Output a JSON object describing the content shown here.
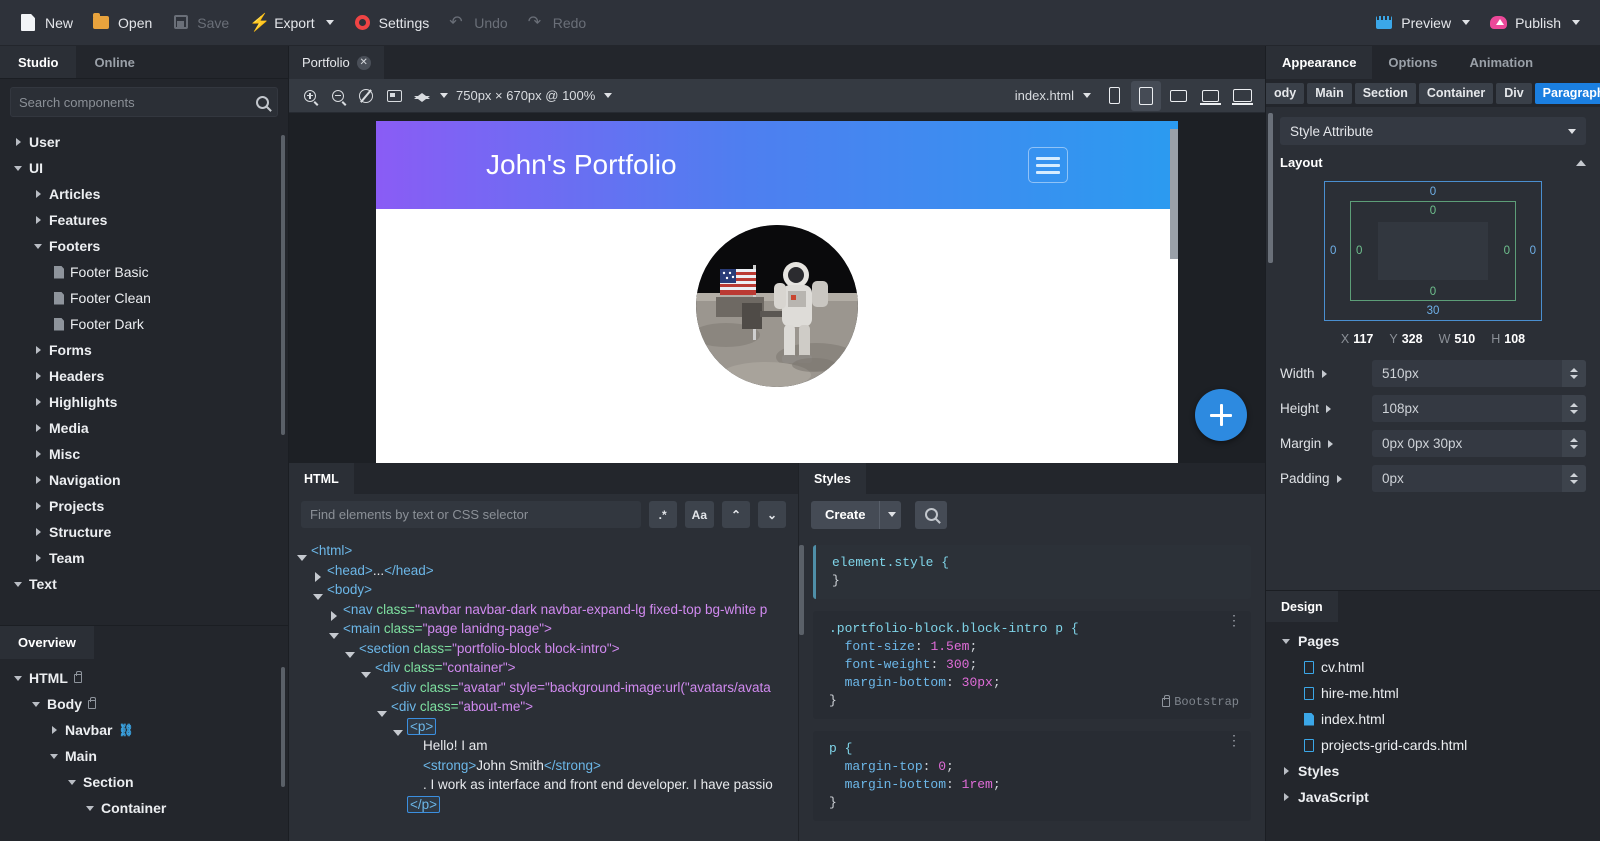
{
  "toolbar": {
    "items": [
      {
        "label": "New",
        "icon": "new-document-icon",
        "enabled": true
      },
      {
        "label": "Open",
        "icon": "open-folder-icon",
        "enabled": true
      },
      {
        "label": "Save",
        "icon": "save-disk-icon",
        "enabled": false
      },
      {
        "label": "Export",
        "icon": "export-bolt-icon",
        "enabled": true,
        "caret": true
      },
      {
        "label": "Settings",
        "icon": "settings-gear-icon",
        "enabled": true
      },
      {
        "label": "Undo",
        "icon": "undo-arrow-icon",
        "enabled": false
      },
      {
        "label": "Redo",
        "icon": "redo-arrow-icon",
        "enabled": false
      }
    ],
    "right_items": [
      {
        "label": "Preview",
        "icon": "preview-icon",
        "caret": true
      },
      {
        "label": "Publish",
        "icon": "publish-cloud-icon",
        "caret": true
      }
    ]
  },
  "left_panel": {
    "tabs": [
      {
        "label": "Studio",
        "active": true
      },
      {
        "label": "Online",
        "active": false
      }
    ],
    "search": {
      "placeholder": "Search components",
      "value": ""
    },
    "tree": [
      {
        "label": "User",
        "depth": 0,
        "state": "closed",
        "bold": true
      },
      {
        "label": "UI",
        "depth": 0,
        "state": "open",
        "bold": true
      },
      {
        "label": "Articles",
        "depth": 1,
        "state": "closed",
        "bold": true
      },
      {
        "label": "Features",
        "depth": 1,
        "state": "closed",
        "bold": true
      },
      {
        "label": "Footers",
        "depth": 1,
        "state": "open",
        "bold": true
      },
      {
        "label": "Footer Basic",
        "depth": 2,
        "state": "leaf",
        "bold": false
      },
      {
        "label": "Footer Clean",
        "depth": 2,
        "state": "leaf",
        "bold": false
      },
      {
        "label": "Footer Dark",
        "depth": 2,
        "state": "leaf",
        "bold": false
      },
      {
        "label": "Forms",
        "depth": 1,
        "state": "closed",
        "bold": true
      },
      {
        "label": "Headers",
        "depth": 1,
        "state": "closed",
        "bold": true
      },
      {
        "label": "Highlights",
        "depth": 1,
        "state": "closed",
        "bold": true
      },
      {
        "label": "Media",
        "depth": 1,
        "state": "closed",
        "bold": true
      },
      {
        "label": "Misc",
        "depth": 1,
        "state": "closed",
        "bold": true
      },
      {
        "label": "Navigation",
        "depth": 1,
        "state": "closed",
        "bold": true
      },
      {
        "label": "Projects",
        "depth": 1,
        "state": "closed",
        "bold": true
      },
      {
        "label": "Structure",
        "depth": 1,
        "state": "closed",
        "bold": true
      },
      {
        "label": "Team",
        "depth": 1,
        "state": "closed",
        "bold": true
      },
      {
        "label": "Text",
        "depth": 0,
        "state": "open",
        "bold": true
      }
    ],
    "overview": {
      "tab_label": "Overview",
      "tree": [
        {
          "label": "HTML",
          "depth": 0,
          "state": "open",
          "lock": true
        },
        {
          "label": "Body",
          "depth": 1,
          "state": "open",
          "lock": true
        },
        {
          "label": "Navbar",
          "depth": 2,
          "state": "closed",
          "link": true
        },
        {
          "label": "Main",
          "depth": 2,
          "state": "open"
        },
        {
          "label": "Section",
          "depth": 3,
          "state": "open"
        },
        {
          "label": "Container",
          "depth": 4,
          "state": "open"
        }
      ]
    }
  },
  "canvas": {
    "tab": {
      "label": "Portfolio",
      "close": "✕"
    },
    "zoom_label": "750px × 670px @ 100%",
    "file_label": "index.html",
    "tool_icons": [
      "zoom-in-icon",
      "zoom-out-icon",
      "no-style-icon",
      "fit-screen-icon",
      "layers-icon"
    ],
    "devices": [
      "phone-icon",
      "tablet-icon",
      "monitor-icon",
      "laptop-icon",
      "desktop-wide-icon"
    ],
    "active_device_index": 1,
    "preview": {
      "site_title": "John's Portfolio",
      "menu_icon": "hamburger-menu-icon",
      "avatar_alt": "astronaut-on-moon-avatar",
      "gradient_from": "#8a5cf5",
      "gradient_to": "#2b9bf0"
    },
    "fab_label": "+"
  },
  "html_panel": {
    "tab_label": "HTML",
    "find": {
      "placeholder": "Find elements by text or CSS selector",
      "value": ""
    },
    "buttons": [
      ".*",
      "Aa",
      "⌃",
      "⌄"
    ],
    "rows": [
      {
        "indent": 0,
        "tri": "o",
        "parts": [
          {
            "t": "tag",
            "v": "<html>"
          }
        ]
      },
      {
        "indent": 1,
        "tri": "c",
        "parts": [
          {
            "t": "tag",
            "v": "<head>"
          },
          {
            "t": "txt",
            "v": "..."
          },
          {
            "t": "tag",
            "v": "</head>"
          }
        ]
      },
      {
        "indent": 1,
        "tri": "o",
        "parts": [
          {
            "t": "tag",
            "v": "<body>"
          }
        ]
      },
      {
        "indent": 2,
        "tri": "c",
        "parts": [
          {
            "t": "tag",
            "v": "<nav "
          },
          {
            "t": "attr",
            "v": "class="
          },
          {
            "t": "val",
            "v": "\"navbar navbar-dark navbar-expand-lg fixed-top bg-white p"
          }
        ]
      },
      {
        "indent": 2,
        "tri": "o",
        "parts": [
          {
            "t": "tag",
            "v": "<main "
          },
          {
            "t": "attr",
            "v": "class="
          },
          {
            "t": "val",
            "v": "\"page lanidng-page\">"
          }
        ]
      },
      {
        "indent": 3,
        "tri": "o",
        "parts": [
          {
            "t": "tag",
            "v": "<section "
          },
          {
            "t": "attr",
            "v": "class="
          },
          {
            "t": "val",
            "v": "\"portfolio-block block-intro\">"
          }
        ]
      },
      {
        "indent": 4,
        "tri": "o",
        "parts": [
          {
            "t": "tag",
            "v": "<div "
          },
          {
            "t": "attr",
            "v": "class="
          },
          {
            "t": "val",
            "v": "\"container\">"
          }
        ]
      },
      {
        "indent": 5,
        "tri": "n",
        "parts": [
          {
            "t": "tag",
            "v": "<div "
          },
          {
            "t": "attr",
            "v": "class="
          },
          {
            "t": "val",
            "v": "\"avatar\" style=\"background-image:url(\"avatars/avata"
          }
        ]
      },
      {
        "indent": 5,
        "tri": "o",
        "parts": [
          {
            "t": "tag",
            "v": "<div "
          },
          {
            "t": "attr",
            "v": "class="
          },
          {
            "t": "val",
            "v": "\"about-me\">"
          }
        ]
      },
      {
        "indent": 6,
        "tri": "o",
        "selected": true,
        "parts": [
          {
            "t": "tag",
            "v": "<p>"
          }
        ]
      },
      {
        "indent": 7,
        "tri": "n",
        "parts": [
          {
            "t": "txt",
            "v": "Hello! I am"
          }
        ]
      },
      {
        "indent": 7,
        "tri": "n",
        "parts": [
          {
            "t": "tag",
            "v": "<strong>"
          },
          {
            "t": "txt",
            "v": "John Smith"
          },
          {
            "t": "tag",
            "v": "</strong>"
          }
        ]
      },
      {
        "indent": 7,
        "tri": "n",
        "parts": [
          {
            "t": "txt",
            "v": ". I work as interface and front end developer. I have passio"
          }
        ]
      },
      {
        "indent": 6,
        "tri": "n",
        "selected": true,
        "parts": [
          {
            "t": "tag",
            "v": "</p>"
          }
        ]
      }
    ]
  },
  "styles_panel": {
    "tab_label": "Styles",
    "create_label": "Create",
    "search_icon": "search-icon",
    "rules": [
      {
        "selector": "element.style {",
        "declarations": [],
        "close": "}",
        "source": "",
        "first": true
      },
      {
        "selector": ".portfolio-block.block-intro p {",
        "declarations": [
          {
            "prop": "font-size",
            "value": "1.5em"
          },
          {
            "prop": "font-weight",
            "value": "300"
          },
          {
            "prop": "margin-bottom",
            "value": "30px"
          }
        ],
        "close": "}",
        "source": "Bootstrap"
      },
      {
        "selector": "p {",
        "declarations": [
          {
            "prop": "margin-top",
            "value": "0"
          },
          {
            "prop": "margin-bottom",
            "value": "1rem"
          }
        ],
        "close": "}",
        "source": ""
      }
    ]
  },
  "right_panel": {
    "tabs": [
      {
        "label": "Appearance",
        "active": true
      },
      {
        "label": "Options",
        "active": false
      },
      {
        "label": "Animation",
        "active": false
      }
    ],
    "breadcrumbs": [
      {
        "label": "ody",
        "active": false,
        "clipped": true
      },
      {
        "label": "Main",
        "active": false
      },
      {
        "label": "Section",
        "active": false
      },
      {
        "label": "Container",
        "active": false
      },
      {
        "label": "Div",
        "active": false
      },
      {
        "label": "Paragraph",
        "active": true
      }
    ],
    "style_attribute": "Style Attribute",
    "layout": {
      "title": "Layout",
      "margin": {
        "top": "0",
        "right": "0",
        "bottom": "30",
        "left": "0"
      },
      "padding": {
        "top": "0",
        "right": "0",
        "bottom": "0",
        "left": "0"
      },
      "metrics": [
        {
          "key": "X",
          "value": "117"
        },
        {
          "key": "Y",
          "value": "328"
        },
        {
          "key": "W",
          "value": "510"
        },
        {
          "key": "H",
          "value": "108"
        }
      ],
      "properties": [
        {
          "label": "Width",
          "value": "510px"
        },
        {
          "label": "Height",
          "value": "108px"
        },
        {
          "label": "Margin",
          "value": "0px 0px 30px"
        },
        {
          "label": "Padding",
          "value": "0px"
        }
      ]
    },
    "design": {
      "tab_label": "Design",
      "tree": [
        {
          "label": "Pages",
          "depth": 0,
          "state": "open",
          "bold": true
        },
        {
          "label": "cv.html",
          "depth": 1,
          "state": "file",
          "bold": false,
          "active": false
        },
        {
          "label": "hire-me.html",
          "depth": 1,
          "state": "file",
          "bold": false,
          "active": false
        },
        {
          "label": "index.html",
          "depth": 1,
          "state": "file",
          "bold": false,
          "active": true
        },
        {
          "label": "projects-grid-cards.html",
          "depth": 1,
          "state": "file",
          "bold": false,
          "active": false
        },
        {
          "label": "Styles",
          "depth": 0,
          "state": "closed",
          "bold": true
        },
        {
          "label": "JavaScript",
          "depth": 0,
          "state": "closed",
          "bold": true
        }
      ]
    }
  },
  "colors": {
    "accent_blue": "#1b7fe0",
    "publish_pink": "#ec4899",
    "export_green": "#4ade80",
    "settings_red": "#ef4444",
    "open_orange": "#e8a33d"
  }
}
